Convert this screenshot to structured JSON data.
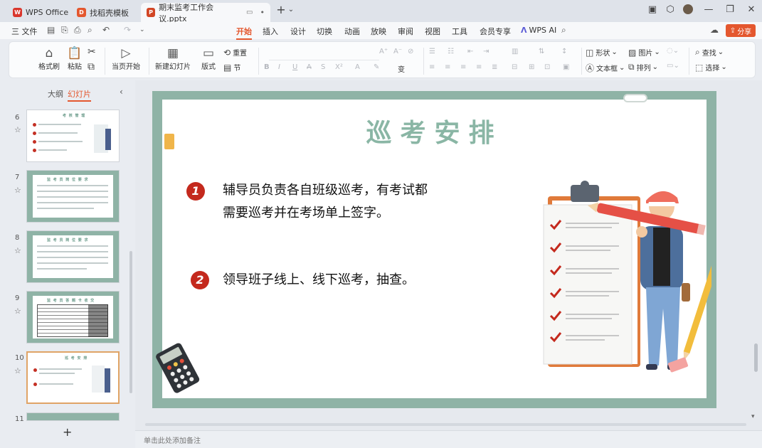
{
  "titlebar": {
    "tabs": [
      {
        "label": "WPS Office",
        "icon": "wps-logo-icon",
        "color": "#d9362c"
      },
      {
        "label": "找稻壳模板",
        "icon": "docer-icon",
        "color": "#e4572e"
      },
      {
        "label": "期末监考工作会议.pptx",
        "icon": "ppt-file-icon",
        "color": "#d24625"
      }
    ],
    "new_tab": "+",
    "tab_dropdown": "⌄"
  },
  "menubar": {
    "file": "三 文件",
    "items": [
      "开始",
      "插入",
      "设计",
      "切换",
      "动画",
      "放映",
      "审阅",
      "视图",
      "工具",
      "会员专享"
    ],
    "active": "开始",
    "wps_ai": "WPS AI",
    "share": "分享"
  },
  "ribbon": {
    "format_painter": "格式刷",
    "paste": "粘贴",
    "play_current": "当页开始",
    "new_slide": "新建幻灯片",
    "layout": "版式",
    "reset": "重置",
    "section": "节",
    "shape": "形状",
    "picture": "图片",
    "textbox": "文本框",
    "arrange": "排列",
    "find": "查找",
    "select": "选择"
  },
  "slidepanel": {
    "tab_outline": "大纲",
    "tab_slides": "幻灯片",
    "slide_numbers": [
      "6",
      "7",
      "8",
      "9",
      "10",
      "11"
    ],
    "selected": "10",
    "add": "+"
  },
  "slide": {
    "title": "巡考安排",
    "items": [
      {
        "number": "1",
        "lines": [
          "辅导员负责各自班级巡考，有考试都",
          "需要巡考并在考场单上签字。"
        ]
      },
      {
        "number": "2",
        "lines": [
          "领导班子线上、线下巡考，抽查。"
        ]
      }
    ]
  },
  "notes": {
    "placeholder": "单击此处添加备注"
  },
  "colors": {
    "accent": "#e4572e",
    "slide_frame": "#8fb3a6",
    "title": "#8ab6a5",
    "badge": "#c4291d"
  }
}
